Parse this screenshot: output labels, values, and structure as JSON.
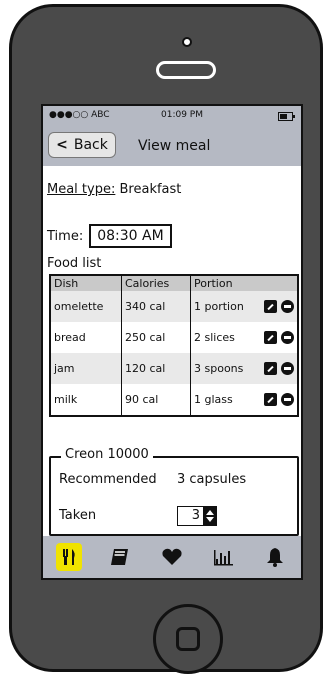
{
  "status_bar": {
    "carrier": "●●●○○ ABC",
    "time": "01:09 PM"
  },
  "nav": {
    "back_label": "Back",
    "title": "View meal"
  },
  "meal": {
    "type_label": "Meal type:",
    "type_value": "Breakfast",
    "time_label": "Time:",
    "time_value": "08:30 AM"
  },
  "food_list": {
    "title": "Food list",
    "columns": [
      "Dish",
      "Calories",
      "Portion"
    ],
    "rows": [
      {
        "dish": "omelette",
        "calories": "340 cal",
        "portion": "1 portion"
      },
      {
        "dish": "bread",
        "calories": "250 cal",
        "portion": "2 slices"
      },
      {
        "dish": "jam",
        "calories": "120 cal",
        "portion": "3 spoons"
      },
      {
        "dish": "milk",
        "calories": "90 cal",
        "portion": "1 glass"
      }
    ]
  },
  "creon": {
    "title": "Creon 10000",
    "recommended_label": "Recommended",
    "recommended_value": "3 capsules",
    "taken_label": "Taken",
    "taken_value": "3"
  },
  "tabs": [
    "meal-icon",
    "book-icon",
    "heart-icon",
    "chart-icon",
    "bell-icon"
  ],
  "colors": {
    "bar": "#b5b9c3",
    "active_tab": "#f0e300"
  }
}
